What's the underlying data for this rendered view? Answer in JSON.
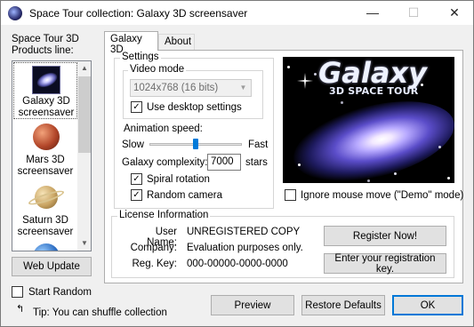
{
  "window": {
    "title": "Space Tour collection:  Galaxy 3D screensaver",
    "minimize_glyph": "—",
    "maximize_glyph": "☐",
    "close_glyph": "✕"
  },
  "sidebar": {
    "heading": "Space Tour 3D Products line:",
    "products": [
      {
        "label": "Galaxy 3D screensaver",
        "icon": "galaxy-icon",
        "selected": true
      },
      {
        "label": "Mars 3D screensaver",
        "icon": "mars-icon",
        "selected": false
      },
      {
        "label": "Saturn 3D screensaver",
        "icon": "saturn-icon",
        "selected": false
      },
      {
        "label": "",
        "icon": "earth-icon",
        "selected": false
      }
    ],
    "web_update": "Web Update",
    "start_random": "Start Random",
    "tip": "Tip: You can shuffle collection"
  },
  "tabs": [
    {
      "label": "Galaxy 3D",
      "active": true
    },
    {
      "label": "About",
      "active": false
    }
  ],
  "settings": {
    "group_label": "Settings",
    "video_mode_label": "Video mode",
    "video_mode_value": "1024x768 (16 bits)",
    "use_desktop": "Use desktop settings",
    "animation_speed_label": "Animation speed:",
    "slow": "Slow",
    "fast": "Fast",
    "animation_speed_level": 0.5,
    "complexity_label": "Galaxy complexity:",
    "complexity_value": "7000",
    "complexity_unit": "stars",
    "spiral_rotation": "Spiral rotation",
    "random_camera": "Random camera",
    "checked_mark": "✓"
  },
  "preview": {
    "logo_title": "Galaxy",
    "logo_subtitle": "3D SPACE TOUR",
    "ignore_mouse": "Ignore mouse move (\"Demo\" mode)"
  },
  "license": {
    "group_label": "License Information",
    "user_name_label": "User Name:",
    "user_name_value": "UNREGISTERED COPY",
    "company_label": "Company:",
    "company_value": "Evaluation purposes only.",
    "reg_key_label": "Reg. Key:",
    "reg_key_value": "000-00000-0000-0000",
    "register_now": "Register Now!",
    "enter_key": "Enter your registration key."
  },
  "footer": {
    "preview": "Preview",
    "restore_defaults": "Restore Defaults",
    "ok": "OK"
  }
}
